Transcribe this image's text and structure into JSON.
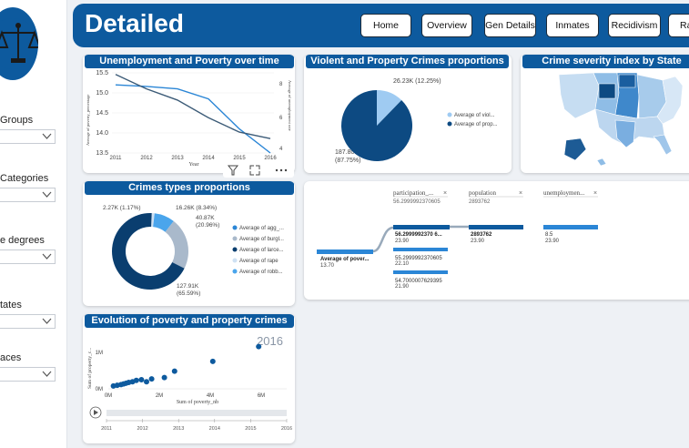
{
  "header": {
    "title": "Detailed",
    "nav": [
      "Home",
      "Overview",
      "Gen Details",
      "Inmates",
      "Recidivism",
      "Ra"
    ]
  },
  "slicers": [
    "Groups",
    "Categories",
    "e degrees",
    "tates",
    "aces"
  ],
  "cards": {
    "unemployment": {
      "title": "Unemployment and Poverty over time",
      "y_left_label": "Average of poverty_percentage",
      "y_right_label": "Average of unemployment rate",
      "x_label": "Year",
      "y_left_ticks": [
        "15.5",
        "15.0",
        "14.5",
        "14.0",
        "13.5"
      ],
      "y_right_ticks": [
        "8",
        "6",
        "4"
      ],
      "x_ticks": [
        "2011",
        "2012",
        "2013",
        "2014",
        "2015",
        "2016"
      ]
    },
    "violent": {
      "title": "Violent and Property Crimes proportions",
      "label_small": "26.23K (12.25%)",
      "label_large_1": "187.80K",
      "label_large_2": "(87.75%)",
      "legend": [
        "Average of viol...",
        "Average of prop..."
      ]
    },
    "severity": {
      "title": "Crime severity index by State"
    },
    "crimes_types": {
      "title": "Crimes types proportions",
      "labels": [
        "2.27K (1.17%)",
        "16.26K (8.34%)",
        "40.87K",
        "(20.96%)",
        "127.91K",
        "(65.59%)"
      ],
      "legend": [
        "Average of agg_...",
        "Average of burgl...",
        "Average of larce...",
        "Average of rape",
        "Average of robb..."
      ]
    },
    "decomp": {
      "col_headers": [
        "participation_...",
        "population",
        "unemploymen..."
      ],
      "col_sub": [
        "56.2999992370605",
        "2893762",
        ""
      ],
      "root_label": "Average of pover...",
      "root_value": "13.70",
      "nodes": [
        {
          "label": "56.2999992370 6...",
          "value": "23.90"
        },
        {
          "label": "55.2999992370605",
          "value": "22.10"
        },
        {
          "label": "54.7000007629395",
          "value": "21.90"
        }
      ],
      "pop_node": {
        "label": "2893762",
        "value": "23.90"
      },
      "unemp_node": {
        "label": "8.5",
        "value": "23.90"
      }
    },
    "evolution": {
      "title": "Evolution of poverty and property crimes",
      "year": "2016",
      "x_label": "Sum of poverty_nb",
      "y_label": "Sum of property_c...",
      "x_ticks": [
        "0M",
        "2M",
        "4M",
        "6M"
      ],
      "y_ticks": [
        "1M",
        "0M"
      ],
      "play_years": [
        "2011",
        "2012",
        "2013",
        "2014",
        "2015",
        "2016"
      ]
    }
  },
  "chart_data": [
    {
      "type": "line",
      "title": "Unemployment and Poverty over time",
      "x": [
        2011,
        2012,
        2013,
        2014,
        2015,
        2016
      ],
      "series": [
        {
          "name": "Average of poverty_percentage",
          "values": [
            15.2,
            15.16,
            15.1,
            14.85,
            14.1,
            13.5
          ],
          "axis": "left"
        },
        {
          "name": "Average of unemployment rate",
          "values": [
            8.9,
            8.0,
            7.3,
            6.2,
            5.3,
            4.9
          ],
          "axis": "right"
        }
      ],
      "ylim_left": [
        13.5,
        15.5
      ],
      "ylim_right": [
        4,
        9
      ]
    },
    {
      "type": "pie",
      "title": "Violent and Property Crimes proportions",
      "categories": [
        "Average of violent",
        "Average of property"
      ],
      "values": [
        26.23,
        187.8
      ],
      "colors": [
        "#9fcbf2",
        "#0d4a82"
      ]
    },
    {
      "type": "pie",
      "title": "Crimes types proportions",
      "categories": [
        "agg",
        "burglary",
        "larceny",
        "rape",
        "robbery"
      ],
      "values": [
        0,
        40.87,
        127.91,
        2.27,
        16.26
      ],
      "colors": [
        "#2b86d6",
        "#a9b9cb",
        "#0a3e6f",
        "#cfe1f3",
        "#4aa5ec"
      ]
    },
    {
      "type": "scatter",
      "title": "Evolution of poverty and property crimes",
      "xlabel": "Sum of poverty_nb",
      "ylabel": "Sum of property_c...",
      "x": [
        0.2,
        0.35,
        0.5,
        0.6,
        0.7,
        0.8,
        0.95,
        1.1,
        1.3,
        1.5,
        1.7,
        2.2,
        2.6,
        4.1,
        5.9
      ],
      "y": [
        0.08,
        0.1,
        0.12,
        0.14,
        0.16,
        0.18,
        0.2,
        0.24,
        0.26,
        0.2,
        0.28,
        0.32,
        0.5,
        0.78,
        1.2
      ],
      "xlim": [
        0,
        7
      ],
      "ylim": [
        0,
        1.5
      ]
    }
  ]
}
